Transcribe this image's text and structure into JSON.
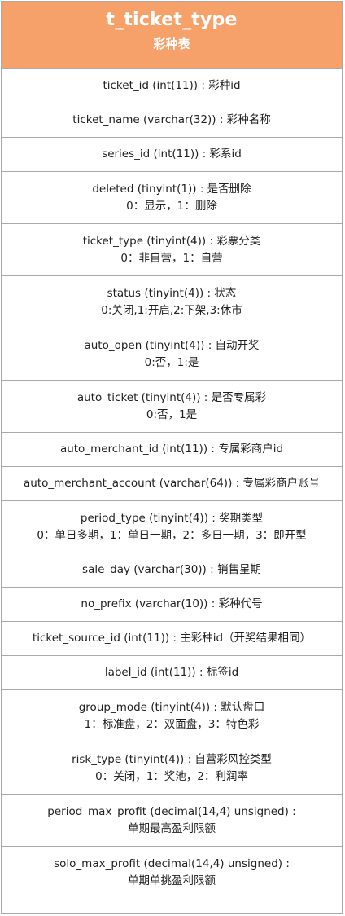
{
  "table": {
    "title": "t_ticket_type",
    "subtitle": "彩种表",
    "fields": [
      {
        "line1": "ticket_id (int(11)) : 彩种id",
        "line2": ""
      },
      {
        "line1": "ticket_name (varchar(32)) : 彩种名称",
        "line2": ""
      },
      {
        "line1": "series_id (int(11)) : 彩系id",
        "line2": ""
      },
      {
        "line1": "deleted (tinyint(1)) : 是否删除",
        "line2": "0：显示，1：删除"
      },
      {
        "line1": "ticket_type (tinyint(4)) : 彩票分类",
        "line2": "0：非自营，1：自营"
      },
      {
        "line1": "status (tinyint(4)) : 状态",
        "line2": "0:关闭,1:开启,2:下架,3:休市"
      },
      {
        "line1": "auto_open (tinyint(4)) : 自动开奖",
        "line2": "0:否，1:是"
      },
      {
        "line1": "auto_ticket (tinyint(4)) : 是否专属彩",
        "line2": "0:否，1是"
      },
      {
        "line1": "auto_merchant_id (int(11)) : 专属彩商户id",
        "line2": ""
      },
      {
        "line1": "auto_merchant_account (varchar(64)) : 专属彩商户账号",
        "line2": ""
      },
      {
        "line1": "period_type (tinyint(4)) : 奖期类型",
        "line2": "0：单日多期，1：单日一期，2：多日一期，3：即开型"
      },
      {
        "line1": "sale_day (varchar(30)) : 销售星期",
        "line2": ""
      },
      {
        "line1": "no_prefix (varchar(10)) : 彩种代号",
        "line2": ""
      },
      {
        "line1": "ticket_source_id (int(11)) : 主彩种id（开奖结果相同）",
        "line2": ""
      },
      {
        "line1": "label_id (int(11)) : 标签id",
        "line2": ""
      },
      {
        "line1": "group_mode (tinyint(4)) : 默认盘口",
        "line2": "1：标准盘，2：双面盘，3：特色彩"
      },
      {
        "line1": "risk_type (tinyint(4)) : 自营彩风控类型",
        "line2": "0：关闭，1：奖池，2：利润率"
      },
      {
        "line1": "period_max_profit (decimal(14,4) unsigned) :",
        "line2": "单期最高盈利限额"
      },
      {
        "line1": "solo_max_profit (decimal(14,4) unsigned) :",
        "line2": "单期单挑盈利限额"
      }
    ]
  },
  "colors": {
    "header_bg": "#f7a16a",
    "header_text": "#ffffff",
    "border": "#a9a9a9",
    "text": "#1f1f1f"
  }
}
